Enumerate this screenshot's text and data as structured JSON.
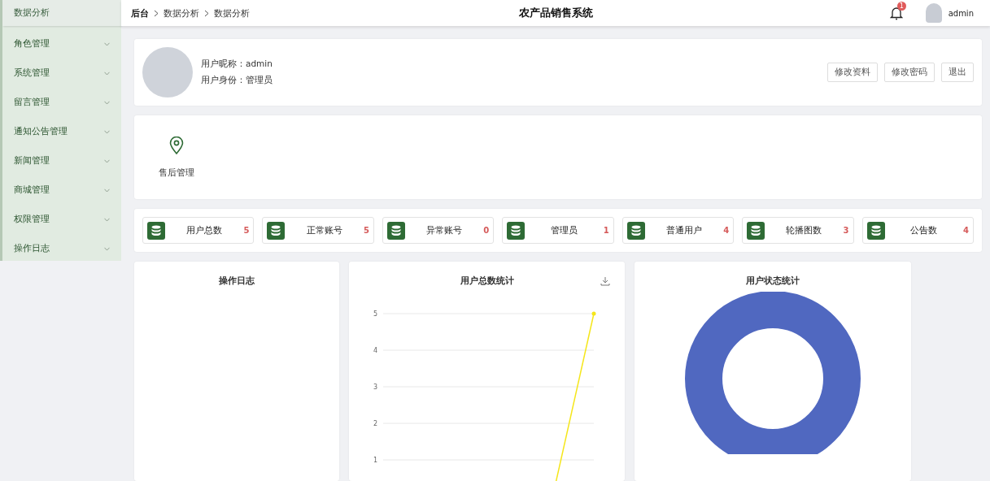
{
  "sidebar": {
    "items": [
      {
        "label": "数据分析",
        "selected": true,
        "expandable": false
      },
      {
        "label": "角色管理",
        "selected": false,
        "expandable": true
      },
      {
        "label": "系统管理",
        "selected": false,
        "expandable": true
      },
      {
        "label": "留言管理",
        "selected": false,
        "expandable": true
      },
      {
        "label": "通知公告管理",
        "selected": false,
        "expandable": true
      },
      {
        "label": "新闻管理",
        "selected": false,
        "expandable": true
      },
      {
        "label": "商城管理",
        "selected": false,
        "expandable": true
      },
      {
        "label": "权限管理",
        "selected": false,
        "expandable": true
      },
      {
        "label": "操作日志",
        "selected": false,
        "expandable": true
      }
    ]
  },
  "header": {
    "breadcrumb": [
      "后台",
      "数据分析",
      "数据分析"
    ],
    "title": "农产品销售系统",
    "notification_count": "1",
    "user": "admin"
  },
  "profile": {
    "nickname_label": "用户昵称：",
    "nickname": "admin",
    "role_label": "用户身份：",
    "role": "管理员",
    "buttons": [
      "修改资料",
      "修改密码",
      "退出"
    ]
  },
  "shortcuts": [
    {
      "label": "售后管理"
    }
  ],
  "stats": [
    {
      "label": "用户总数",
      "value": "5"
    },
    {
      "label": "正常账号",
      "value": "5"
    },
    {
      "label": "异常账号",
      "value": "0"
    },
    {
      "label": "管理员",
      "value": "1"
    },
    {
      "label": "普通用户",
      "value": "4"
    },
    {
      "label": "轮播图数",
      "value": "3"
    },
    {
      "label": "公告数",
      "value": "4"
    }
  ],
  "panels": {
    "log": {
      "title": "操作日志"
    },
    "user_total": {
      "title": "用户总数统计",
      "axis_labels": [
        "5",
        "4",
        "3",
        "2",
        "1"
      ]
    },
    "user_status": {
      "title": "用户状态统计"
    }
  }
}
